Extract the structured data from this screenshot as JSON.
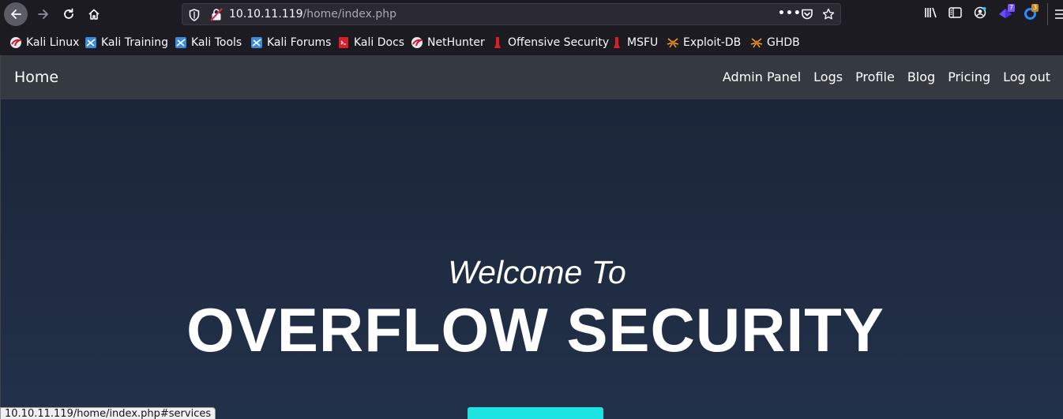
{
  "browser": {
    "url_host": "10.10.11.119",
    "url_path": "/home/index.php",
    "extension_badges": [
      "7",
      "3"
    ],
    "status_url": "10.10.11.119/home/index.php#services"
  },
  "bookmarks": [
    {
      "label": "Kali Linux",
      "icon": "kali-dragon-icon"
    },
    {
      "label": "Kali Training",
      "icon": "kali-training-icon"
    },
    {
      "label": "Kali Tools",
      "icon": "kali-tools-icon"
    },
    {
      "label": "Kali Forums",
      "icon": "kali-forums-icon"
    },
    {
      "label": "Kali Docs",
      "icon": "kali-docs-icon"
    },
    {
      "label": "NetHunter",
      "icon": "nethunter-icon"
    },
    {
      "label": "Offensive Security",
      "icon": "offsec-icon"
    },
    {
      "label": "MSFU",
      "icon": "msfu-icon"
    },
    {
      "label": "Exploit-DB",
      "icon": "exploitdb-icon"
    },
    {
      "label": "GHDB",
      "icon": "ghdb-icon"
    }
  ],
  "site": {
    "brand": "Home",
    "nav": [
      "Admin Panel",
      "Logs",
      "Profile",
      "Blog",
      "Pricing",
      "Log out"
    ],
    "welcome": "Welcome To",
    "headline": "OVERFLOW SECURITY"
  },
  "colors": {
    "navbar": "#343a40",
    "hero_top": "#1b2436",
    "hero_bottom": "#22314a",
    "cta": "#1ee3e3"
  }
}
